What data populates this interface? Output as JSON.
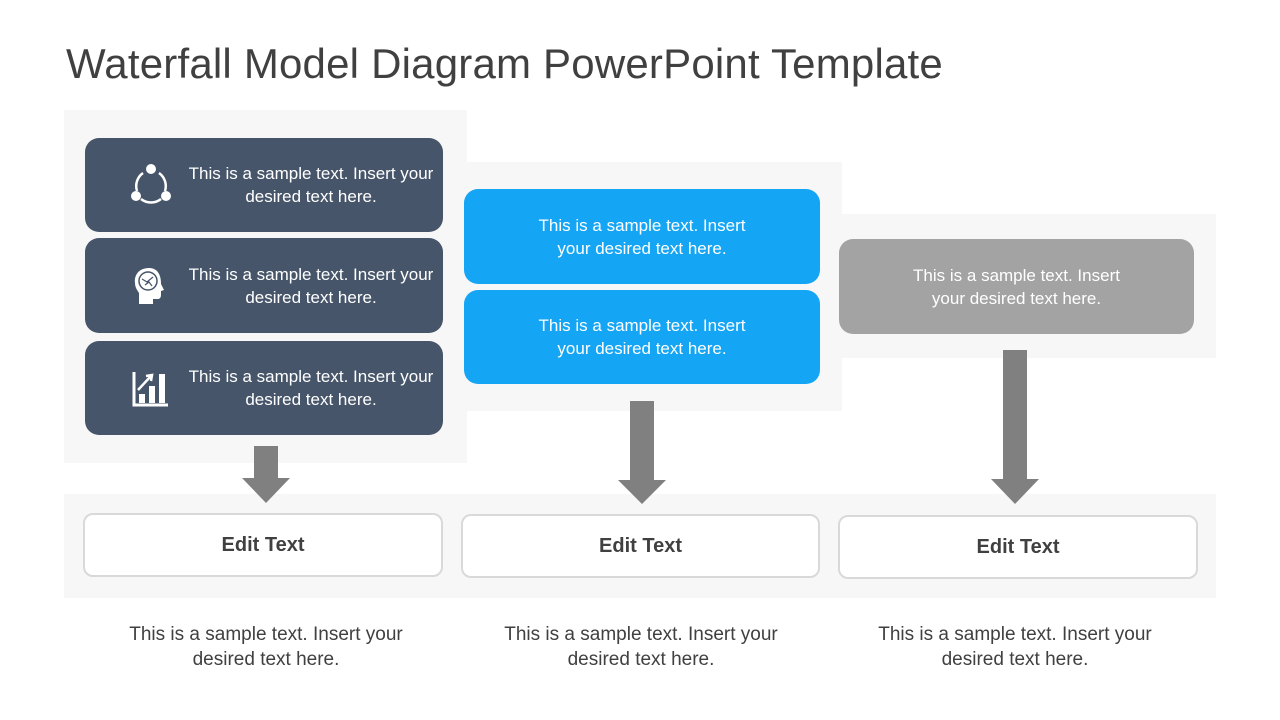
{
  "title": "Waterfall Model Diagram PowerPoint Template",
  "colors": {
    "dark": "#465569",
    "blue": "#14a5f5",
    "grey": "#a3a3a3",
    "arrow": "#808080",
    "panel": "#f7f7f7"
  },
  "columns": [
    {
      "boxes": [
        {
          "icon": "share-network-icon",
          "text": "This is a sample text. Insert your desired text here."
        },
        {
          "icon": "brain-head-icon",
          "text": "This is a sample text. Insert your desired text here."
        },
        {
          "icon": "bar-chart-growth-icon",
          "text": "This is a sample text. Insert your desired text here."
        }
      ],
      "edit_label": "Edit Text",
      "description": "This is a sample text. Insert your desired text here."
    },
    {
      "boxes": [
        {
          "text": "This is a sample text. Insert your desired text here."
        },
        {
          "text": "This is a sample text. Insert your desired text here."
        }
      ],
      "edit_label": "Edit Text",
      "description": "This is a sample text. Insert your desired text here."
    },
    {
      "boxes": [
        {
          "text": "This is a sample text. Insert your desired text here."
        }
      ],
      "edit_label": "Edit Text",
      "description": "This is a sample text. Insert your desired text here."
    }
  ]
}
